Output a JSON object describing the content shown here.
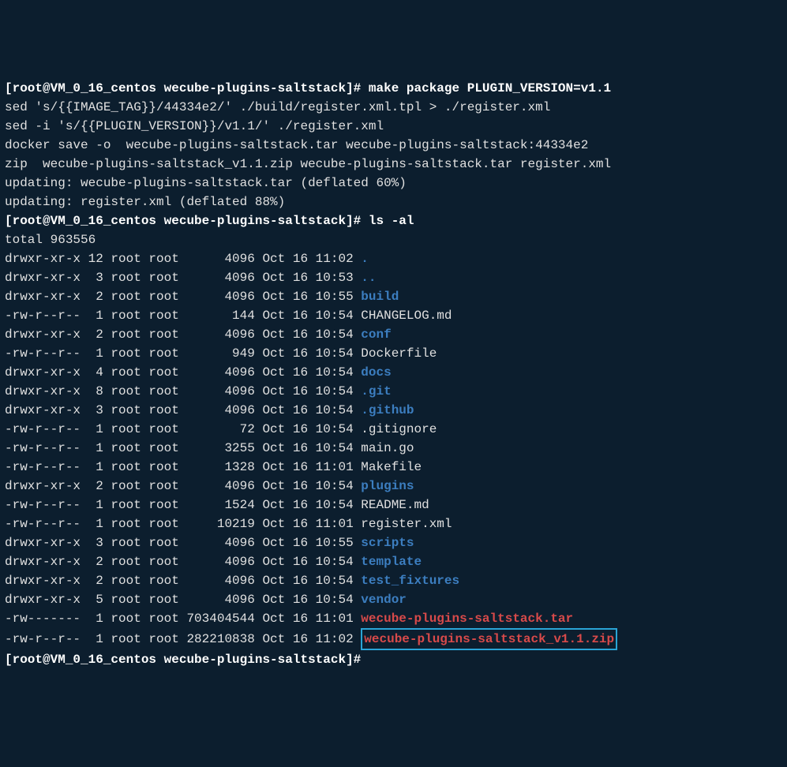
{
  "prompt": {
    "user": "root",
    "host": "VM_0_16_centos",
    "dir": "wecube-plugins-saltstack"
  },
  "commands": {
    "make": "make package PLUGIN_VERSION=v1.1",
    "ls": "ls -al"
  },
  "output": {
    "l1": "sed 's/{{IMAGE_TAG}}/44334e2/' ./build/register.xml.tpl > ./register.xml",
    "l2": "sed -i 's/{{PLUGIN_VERSION}}/v1.1/' ./register.xml",
    "l3": "docker save -o  wecube-plugins-saltstack.tar wecube-plugins-saltstack:44334e2",
    "l4": "zip  wecube-plugins-saltstack_v1.1.zip wecube-plugins-saltstack.tar register.xml",
    "l5": "updating: wecube-plugins-saltstack.tar (deflated 60%)",
    "l6": "updating: register.xml (deflated 88%)",
    "total": "total 963556"
  },
  "ls": [
    {
      "perm": "drwxr-xr-x",
      "links": "12",
      "owner": "root",
      "group": "root",
      "size": "4096",
      "date": "Oct 16",
      "time": "11:02",
      "name": ".",
      "type": "dir"
    },
    {
      "perm": "drwxr-xr-x",
      "links": "3",
      "owner": "root",
      "group": "root",
      "size": "4096",
      "date": "Oct 16",
      "time": "10:53",
      "name": "..",
      "type": "dir"
    },
    {
      "perm": "drwxr-xr-x",
      "links": "2",
      "owner": "root",
      "group": "root",
      "size": "4096",
      "date": "Oct 16",
      "time": "10:55",
      "name": "build",
      "type": "dir"
    },
    {
      "perm": "-rw-r--r--",
      "links": "1",
      "owner": "root",
      "group": "root",
      "size": "144",
      "date": "Oct 16",
      "time": "10:54",
      "name": "CHANGELOG.md",
      "type": "file"
    },
    {
      "perm": "drwxr-xr-x",
      "links": "2",
      "owner": "root",
      "group": "root",
      "size": "4096",
      "date": "Oct 16",
      "time": "10:54",
      "name": "conf",
      "type": "dir"
    },
    {
      "perm": "-rw-r--r--",
      "links": "1",
      "owner": "root",
      "group": "root",
      "size": "949",
      "date": "Oct 16",
      "time": "10:54",
      "name": "Dockerfile",
      "type": "file"
    },
    {
      "perm": "drwxr-xr-x",
      "links": "4",
      "owner": "root",
      "group": "root",
      "size": "4096",
      "date": "Oct 16",
      "time": "10:54",
      "name": "docs",
      "type": "dir"
    },
    {
      "perm": "drwxr-xr-x",
      "links": "8",
      "owner": "root",
      "group": "root",
      "size": "4096",
      "date": "Oct 16",
      "time": "10:54",
      "name": ".git",
      "type": "dir"
    },
    {
      "perm": "drwxr-xr-x",
      "links": "3",
      "owner": "root",
      "group": "root",
      "size": "4096",
      "date": "Oct 16",
      "time": "10:54",
      "name": ".github",
      "type": "dir"
    },
    {
      "perm": "-rw-r--r--",
      "links": "1",
      "owner": "root",
      "group": "root",
      "size": "72",
      "date": "Oct 16",
      "time": "10:54",
      "name": ".gitignore",
      "type": "file"
    },
    {
      "perm": "-rw-r--r--",
      "links": "1",
      "owner": "root",
      "group": "root",
      "size": "3255",
      "date": "Oct 16",
      "time": "10:54",
      "name": "main.go",
      "type": "file"
    },
    {
      "perm": "-rw-r--r--",
      "links": "1",
      "owner": "root",
      "group": "root",
      "size": "1328",
      "date": "Oct 16",
      "time": "11:01",
      "name": "Makefile",
      "type": "file"
    },
    {
      "perm": "drwxr-xr-x",
      "links": "2",
      "owner": "root",
      "group": "root",
      "size": "4096",
      "date": "Oct 16",
      "time": "10:54",
      "name": "plugins",
      "type": "dir"
    },
    {
      "perm": "-rw-r--r--",
      "links": "1",
      "owner": "root",
      "group": "root",
      "size": "1524",
      "date": "Oct 16",
      "time": "10:54",
      "name": "README.md",
      "type": "file"
    },
    {
      "perm": "-rw-r--r--",
      "links": "1",
      "owner": "root",
      "group": "root",
      "size": "10219",
      "date": "Oct 16",
      "time": "11:01",
      "name": "register.xml",
      "type": "file"
    },
    {
      "perm": "drwxr-xr-x",
      "links": "3",
      "owner": "root",
      "group": "root",
      "size": "4096",
      "date": "Oct 16",
      "time": "10:55",
      "name": "scripts",
      "type": "dir"
    },
    {
      "perm": "drwxr-xr-x",
      "links": "2",
      "owner": "root",
      "group": "root",
      "size": "4096",
      "date": "Oct 16",
      "time": "10:54",
      "name": "template",
      "type": "dir"
    },
    {
      "perm": "drwxr-xr-x",
      "links": "2",
      "owner": "root",
      "group": "root",
      "size": "4096",
      "date": "Oct 16",
      "time": "10:54",
      "name": "test_fixtures",
      "type": "dir"
    },
    {
      "perm": "drwxr-xr-x",
      "links": "5",
      "owner": "root",
      "group": "root",
      "size": "4096",
      "date": "Oct 16",
      "time": "10:54",
      "name": "vendor",
      "type": "dir"
    },
    {
      "perm": "-rw-------",
      "links": "1",
      "owner": "root",
      "group": "root",
      "size": "703404544",
      "date": "Oct 16",
      "time": "11:01",
      "name": "wecube-plugins-saltstack.tar",
      "type": "red"
    },
    {
      "perm": "-rw-r--r--",
      "links": "1",
      "owner": "root",
      "group": "root",
      "size": "282210838",
      "date": "Oct 16",
      "time": "11:02",
      "name": "wecube-plugins-saltstack_v1.1.zip",
      "type": "highlight"
    }
  ]
}
